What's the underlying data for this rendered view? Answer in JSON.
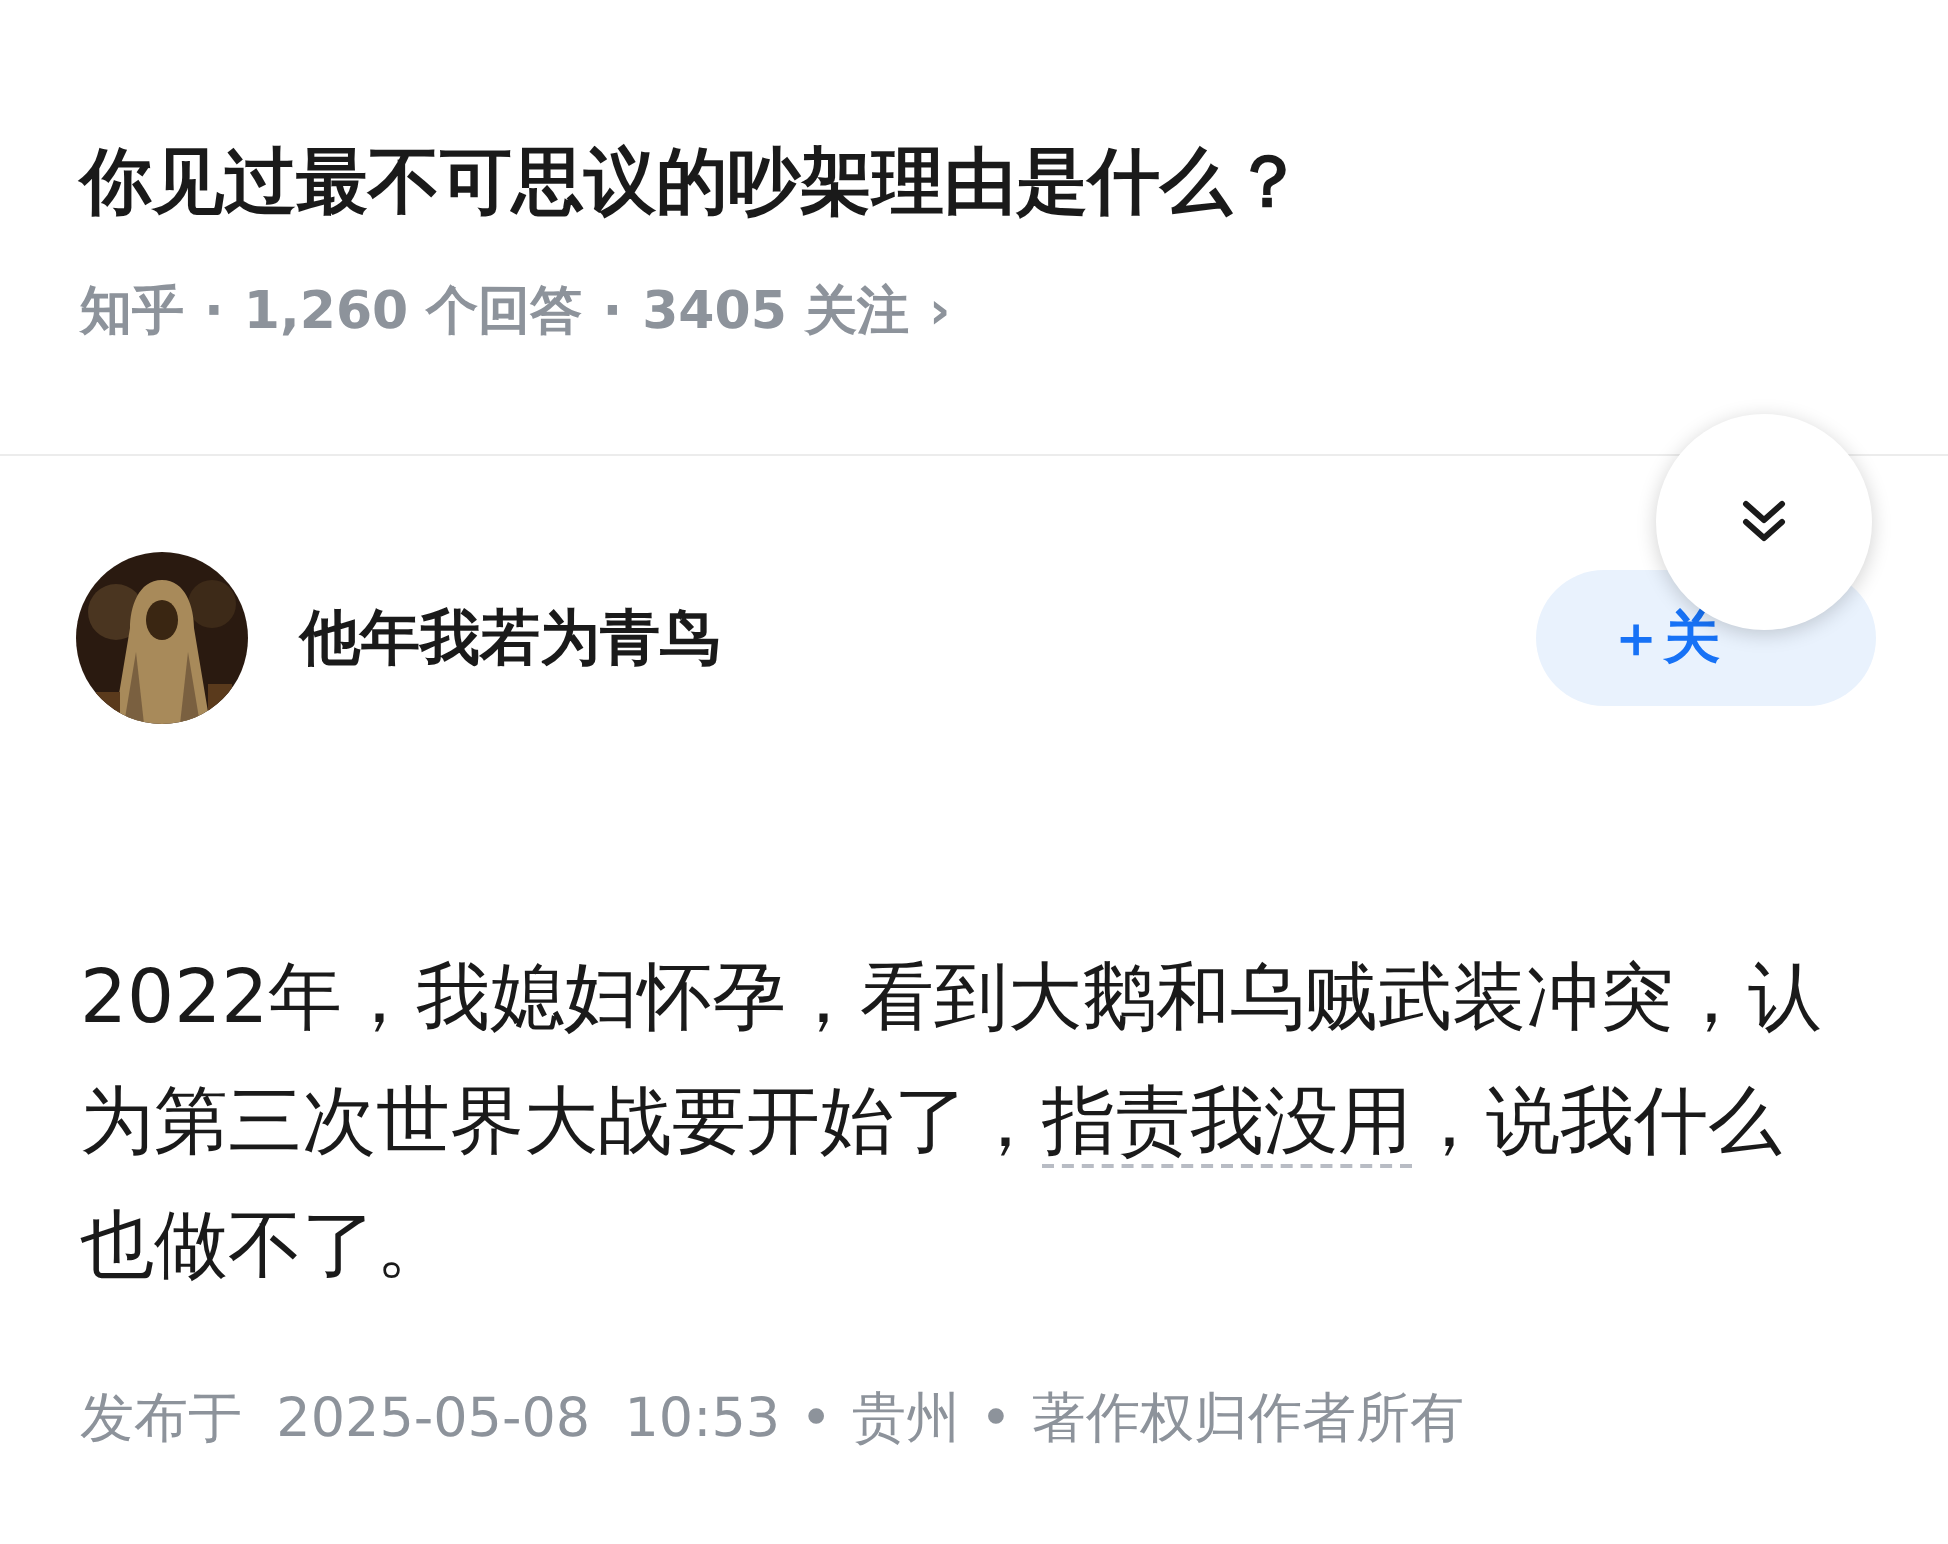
{
  "question": {
    "title": "你见过最不可思议的吵架理由是什么？",
    "source": "知乎",
    "separator": "·",
    "answers": "1,260",
    "answers_label": "个回答",
    "followers": "3405",
    "followers_label": "关注",
    "chevron": "›"
  },
  "author": {
    "name": "他年我若为青鸟",
    "follow_button": "＋关"
  },
  "answer": {
    "parts": [
      {
        "kind": "text",
        "text": "2022年，我媳妇怀孕，看到大鹅和乌贼武装冲突，认为第三次世界大战要开始了，"
      },
      {
        "kind": "link",
        "text": "指责我没用"
      },
      {
        "kind": "text",
        "text": "，说我什么也做不了。"
      }
    ]
  },
  "footer": {
    "separator": "•",
    "published": "发布于  2025-05-08  10:53",
    "location": "贵州",
    "copyright": "著作权归作者所有"
  }
}
